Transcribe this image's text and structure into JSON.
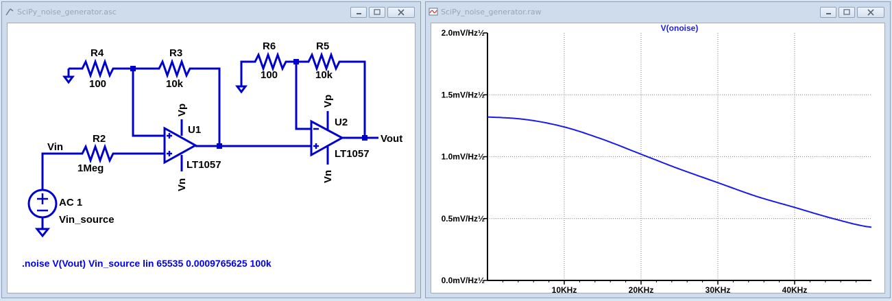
{
  "schematic_window": {
    "title": "SciPy_noise_generator.asc",
    "labels": {
      "r4": "R4",
      "r4_value": "100",
      "r3": "R3",
      "r3_value": "10k",
      "r6": "R6",
      "r6_value": "100",
      "r5": "R5",
      "r5_value": "10k",
      "r2": "R2",
      "r2_value": "1Meg",
      "u1": "U1",
      "u1_model": "LT1057",
      "u2": "U2",
      "u2_model": "LT1057",
      "vp1": "Vp",
      "vn1": "Vn",
      "vp2": "Vp",
      "vn2": "Vn",
      "vin": "Vin",
      "vout": "Vout",
      "source_ac": "AC 1",
      "source_name": "Vin_source"
    },
    "directive": ".noise V(Vout) Vin_source lin 65535 0.0009765625 100k"
  },
  "plot_window": {
    "title": "SciPy_noise_generator.raw"
  },
  "colors": {
    "wire": "#0000cc",
    "trace": "#1a1aee",
    "grid": "#7f7f7f",
    "plot_bg": "#ffffff"
  },
  "chart_data": {
    "type": "line",
    "title": "V(onoise)",
    "xlabel": "",
    "ylabel": "",
    "x_unit": "Hz",
    "xlim": [
      0,
      50000
    ],
    "ylim": [
      0,
      2.0
    ],
    "y_unit": "mV/Hz½",
    "x_ticks": [
      10000,
      20000,
      30000,
      40000
    ],
    "x_tick_labels": [
      "10KHz",
      "20KHz",
      "30KHz",
      "40KHz"
    ],
    "y_ticks": [
      0,
      0.5,
      1.0,
      1.5,
      2.0
    ],
    "y_tick_labels": [
      "0.0mV/Hz½",
      "0.5mV/Hz½",
      "1.0mV/Hz½",
      "1.5mV/Hz½",
      "2.0mV/Hz½"
    ],
    "grid": true,
    "series": [
      {
        "name": "V(onoise)",
        "x": [
          0,
          5000,
          10000,
          15000,
          20000,
          25000,
          30000,
          35000,
          40000,
          45000,
          50000
        ],
        "values": [
          1.32,
          1.3,
          1.24,
          1.14,
          1.02,
          0.9,
          0.79,
          0.68,
          0.59,
          0.5,
          0.43
        ]
      }
    ]
  }
}
